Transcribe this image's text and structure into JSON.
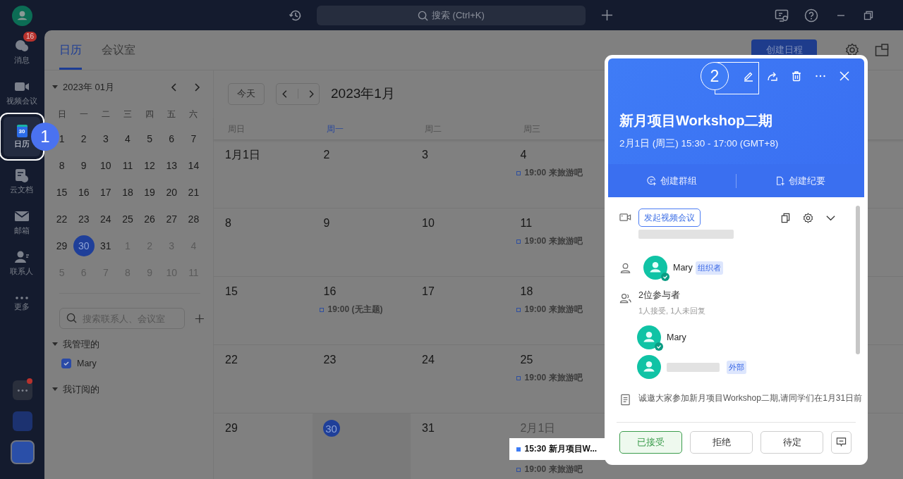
{
  "rail": {
    "items": [
      {
        "kind": "messages",
        "label": "消息",
        "badge": "16",
        "selected": false
      },
      {
        "kind": "video",
        "label": "视频会议",
        "selected": false
      },
      {
        "kind": "calendar",
        "label": "日历",
        "icon_text": "30",
        "callout": "1",
        "selected": true
      },
      {
        "kind": "docs",
        "label": "云文档",
        "selected": false
      },
      {
        "kind": "mail",
        "label": "邮箱",
        "selected": false
      },
      {
        "kind": "contacts",
        "label": "联系人",
        "selected": false
      },
      {
        "kind": "more",
        "label": "更多",
        "selected": false
      }
    ],
    "apps": [
      {
        "kind": "more",
        "notify": true
      },
      {
        "kind": "tile",
        "notify": false
      },
      {
        "kind": "tile-framed",
        "notify": false
      }
    ]
  },
  "topbar": {
    "search_placeholder": "搜索 (Ctrl+K)"
  },
  "tabs": [
    {
      "label": "日历",
      "selected": true
    },
    {
      "label": "会议室",
      "selected": false
    }
  ],
  "create_button": "创建日程",
  "mini_calendar": {
    "title": "2023年 01月",
    "weekdays": [
      "日",
      "一",
      "二",
      "三",
      "四",
      "五",
      "六"
    ],
    "weeks": [
      [
        {
          "d": "1",
          "outside": false,
          "selected": false
        },
        {
          "d": "2",
          "outside": false,
          "selected": false
        },
        {
          "d": "3",
          "outside": false,
          "selected": false
        },
        {
          "d": "4",
          "outside": false,
          "selected": false
        },
        {
          "d": "5",
          "outside": false,
          "selected": false
        },
        {
          "d": "6",
          "outside": false,
          "selected": false
        },
        {
          "d": "7",
          "outside": false,
          "selected": false
        }
      ],
      [
        {
          "d": "8",
          "outside": false,
          "selected": false
        },
        {
          "d": "9",
          "outside": false,
          "selected": false
        },
        {
          "d": "10",
          "outside": false,
          "selected": false
        },
        {
          "d": "11",
          "outside": false,
          "selected": false
        },
        {
          "d": "12",
          "outside": false,
          "selected": false
        },
        {
          "d": "13",
          "outside": false,
          "selected": false
        },
        {
          "d": "14",
          "outside": false,
          "selected": false
        }
      ],
      [
        {
          "d": "15",
          "outside": false,
          "selected": false
        },
        {
          "d": "16",
          "outside": false,
          "selected": false
        },
        {
          "d": "17",
          "outside": false,
          "selected": false
        },
        {
          "d": "18",
          "outside": false,
          "selected": false
        },
        {
          "d": "19",
          "outside": false,
          "selected": false
        },
        {
          "d": "20",
          "outside": false,
          "selected": false
        },
        {
          "d": "21",
          "outside": false,
          "selected": false
        }
      ],
      [
        {
          "d": "22",
          "outside": false,
          "selected": false
        },
        {
          "d": "23",
          "outside": false,
          "selected": false
        },
        {
          "d": "24",
          "outside": false,
          "selected": false
        },
        {
          "d": "25",
          "outside": false,
          "selected": false
        },
        {
          "d": "26",
          "outside": false,
          "selected": false
        },
        {
          "d": "27",
          "outside": false,
          "selected": false
        },
        {
          "d": "28",
          "outside": false,
          "selected": false
        }
      ],
      [
        {
          "d": "29",
          "outside": false,
          "selected": false
        },
        {
          "d": "30",
          "outside": false,
          "selected": true
        },
        {
          "d": "31",
          "outside": false,
          "selected": false
        },
        {
          "d": "1",
          "outside": true,
          "selected": false
        },
        {
          "d": "2",
          "outside": true,
          "selected": false
        },
        {
          "d": "3",
          "outside": true,
          "selected": false
        },
        {
          "d": "4",
          "outside": true,
          "selected": false
        }
      ],
      [
        {
          "d": "5",
          "outside": true,
          "selected": false
        },
        {
          "d": "6",
          "outside": true,
          "selected": false
        },
        {
          "d": "7",
          "outside": true,
          "selected": false
        },
        {
          "d": "8",
          "outside": true,
          "selected": false
        },
        {
          "d": "9",
          "outside": true,
          "selected": false
        },
        {
          "d": "10",
          "outside": true,
          "selected": false
        },
        {
          "d": "11",
          "outside": true,
          "selected": false
        }
      ]
    ]
  },
  "contact_search": {
    "placeholder": "搜索联系人、会议室"
  },
  "groups": [
    {
      "label": "我管理的",
      "expanded": true,
      "items": [
        {
          "label": "Mary",
          "checked": true
        }
      ]
    },
    {
      "label": "我订阅的",
      "expanded": true
    }
  ],
  "calendar": {
    "today_button": "今天",
    "title": "2023年1月",
    "weekdays": [
      {
        "label": "周日",
        "today": false
      },
      {
        "label": "周一",
        "today": true
      },
      {
        "label": "周二",
        "today": false
      },
      {
        "label": "周三",
        "today": false
      }
    ],
    "weeks": [
      [
        {
          "label": "1月1日",
          "today": false,
          "outside": false
        },
        {
          "label": "2",
          "today": false,
          "outside": false
        },
        {
          "label": "3",
          "today": false,
          "outside": false
        },
        {
          "label": "4",
          "today": false,
          "outside": false,
          "events": [
            {
              "text": "19:00 来旅游吧",
              "highlighted": false
            }
          ]
        }
      ],
      [
        {
          "label": "8",
          "today": false,
          "outside": false
        },
        {
          "label": "9",
          "today": false,
          "outside": false
        },
        {
          "label": "10",
          "today": false,
          "outside": false
        },
        {
          "label": "11",
          "today": false,
          "outside": false,
          "events": [
            {
              "text": "19:00 来旅游吧",
              "highlighted": false
            }
          ]
        }
      ],
      [
        {
          "label": "15",
          "today": false,
          "outside": false
        },
        {
          "label": "16",
          "today": false,
          "outside": false,
          "events": [
            {
              "text": "19:00 (无主题)",
              "highlighted": false
            }
          ]
        },
        {
          "label": "17",
          "today": false,
          "outside": false
        },
        {
          "label": "18",
          "today": false,
          "outside": false,
          "events": [
            {
              "text": "19:00 来旅游吧",
              "highlighted": false
            }
          ]
        }
      ],
      [
        {
          "label": "22",
          "today": false,
          "outside": false
        },
        {
          "label": "23",
          "today": false,
          "outside": false
        },
        {
          "label": "24",
          "today": false,
          "outside": false
        },
        {
          "label": "25",
          "today": false,
          "outside": false,
          "events": [
            {
              "text": "19:00 来旅游吧",
              "highlighted": false
            }
          ]
        }
      ],
      [
        {
          "label": "29",
          "today": false,
          "outside": false
        },
        {
          "label": "30",
          "today": true,
          "outside": false
        },
        {
          "label": "31",
          "today": false,
          "outside": false
        },
        {
          "label": "2月1日",
          "today": false,
          "outside": true,
          "events": [
            {
              "text": "15:30 新月项目W...",
              "highlighted": true
            },
            {
              "text": "19:00 来旅游吧",
              "highlighted": false
            }
          ]
        }
      ]
    ]
  },
  "popup": {
    "tools": [
      {
        "kind": "edit",
        "callout": "2"
      },
      {
        "kind": "share"
      },
      {
        "kind": "delete"
      },
      {
        "kind": "more"
      },
      {
        "kind": "close"
      }
    ],
    "title": "新月项目Workshop二期",
    "time": "2月1日 (周三) 15:30 - 17:00 (GMT+8)",
    "actions": [
      {
        "kind": "group",
        "label": "创建群组"
      },
      {
        "kind": "minutes",
        "label": "创建纪要"
      }
    ],
    "video_button": "发起视频会议",
    "organizer": {
      "name": "Mary",
      "tag": "组织者"
    },
    "attendees_summary": "2位参与者",
    "attendees_status": "1人接受, 1人未回复",
    "attendees": [
      {
        "name": "Mary",
        "accepted": true
      },
      {
        "tag": "外部",
        "accepted": false
      }
    ],
    "description": "诚邀大家参加新月项目Workshop二期,请同学们在1月31日前",
    "rsvp": [
      {
        "label": "已接受",
        "selected": true
      },
      {
        "label": "拒绝",
        "selected": false
      },
      {
        "label": "待定",
        "selected": false
      }
    ]
  }
}
